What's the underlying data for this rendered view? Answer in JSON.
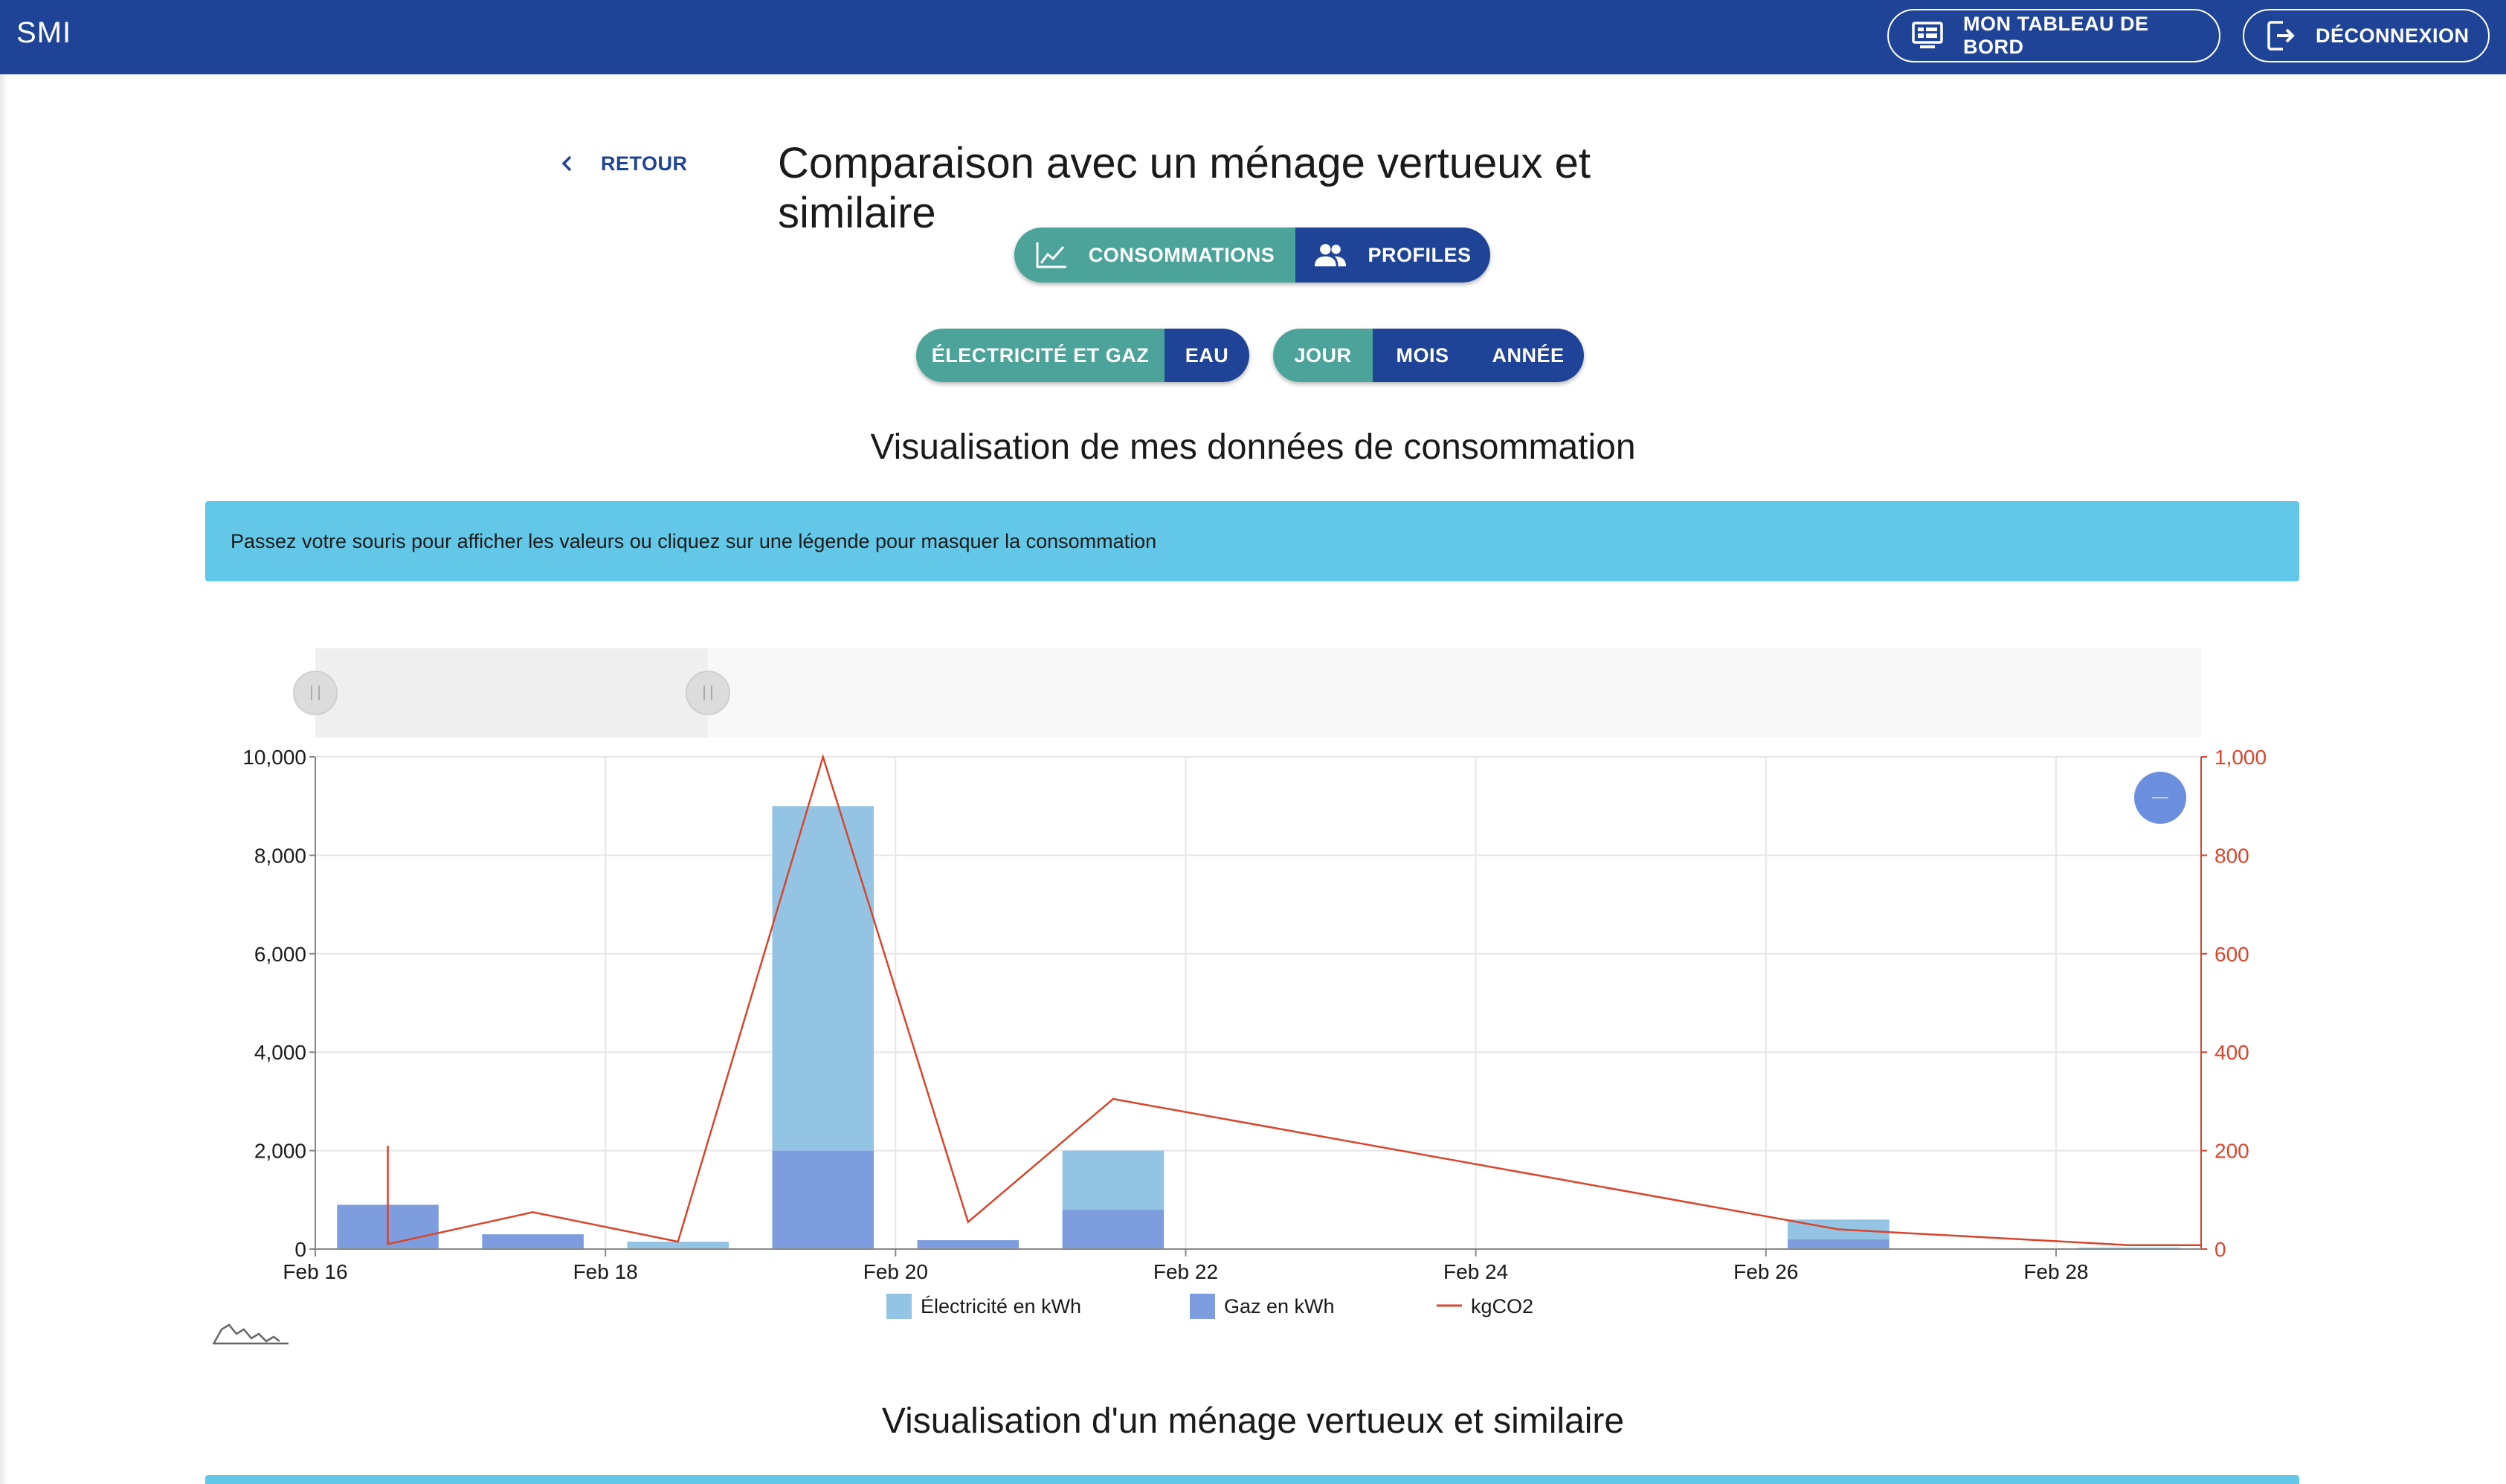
{
  "app": {
    "brand": "SMI",
    "dashboard_label": "MON TABLEAU DE BORD",
    "logout_label": "DÉCONNEXION"
  },
  "header": {
    "back_label": "RETOUR",
    "title": "Comparaison avec un ménage vertueux et similaire"
  },
  "views": {
    "options": [
      "CONSOMMATIONS",
      "PROFILES"
    ],
    "active": "CONSOMMATIONS"
  },
  "energy": {
    "options": [
      "ÉLECTRICITÉ ET GAZ",
      "EAU"
    ],
    "active": "ÉLECTRICITÉ ET GAZ"
  },
  "period": {
    "options": [
      "JOUR",
      "MOIS",
      "ANNÉE"
    ],
    "active": "JOUR"
  },
  "section1": {
    "title": "Visualisation de mes données de consommation",
    "info": "Passez votre souris pour afficher les valeurs ou cliquez sur une légende pour masquer la consommation"
  },
  "section2": {
    "title": "Visualisation d'un ménage vertueux et similaire"
  },
  "colors": {
    "topbar": "#1f4396",
    "toggle_active": "#4ba39a",
    "toggle_inactive": "#1f4396",
    "info_box": "#63c8e7",
    "electricity": "#93c4e3",
    "gas": "#7d9ddf",
    "co2": "#d9442b"
  },
  "chart_data": {
    "type": "bar",
    "stacked": true,
    "x_axis": {
      "type": "date",
      "range": [
        "2021-02-16",
        "2021-02-29"
      ],
      "tick_labels": [
        "Feb 16",
        "Feb 18",
        "Feb 20",
        "Feb 22",
        "Feb 24",
        "Feb 26",
        "Feb 28"
      ]
    },
    "y_left": {
      "range": [
        0,
        10000
      ],
      "tick_labels": [
        "0",
        "2,000",
        "4,000",
        "6,000",
        "8,000",
        "10,000"
      ]
    },
    "y_right": {
      "range": [
        0,
        1000
      ],
      "tick_labels": [
        "0",
        "200",
        "400",
        "600",
        "800",
        "1,000"
      ]
    },
    "grid": true,
    "legend_placement": "bottom-center",
    "series": [
      {
        "name": "Électricité en kWh",
        "type": "bar",
        "axis": "left",
        "points": [
          {
            "date": "2021-02-16",
            "value": 0
          },
          {
            "date": "2021-02-17",
            "value": 0
          },
          {
            "date": "2021-02-18",
            "value": 150
          },
          {
            "date": "2021-02-19",
            "value": 7000
          },
          {
            "date": "2021-02-20",
            "value": 0
          },
          {
            "date": "2021-02-21",
            "value": 1200
          },
          {
            "date": "2021-02-26",
            "value": 400
          },
          {
            "date": "2021-02-28",
            "value": 30
          }
        ]
      },
      {
        "name": "Gaz en kWh",
        "type": "bar",
        "axis": "left",
        "points": [
          {
            "date": "2021-02-16",
            "value": 900
          },
          {
            "date": "2021-02-17",
            "value": 300
          },
          {
            "date": "2021-02-18",
            "value": 0
          },
          {
            "date": "2021-02-19",
            "value": 2000
          },
          {
            "date": "2021-02-20",
            "value": 180
          },
          {
            "date": "2021-02-21",
            "value": 800
          },
          {
            "date": "2021-02-26",
            "value": 200
          },
          {
            "date": "2021-02-28",
            "value": 0
          }
        ]
      },
      {
        "name": "kgCO2",
        "type": "line",
        "axis": "right",
        "points": [
          {
            "date": "2021-02-16",
            "value": 10
          },
          {
            "date": "2021-02-17",
            "value": 75
          },
          {
            "date": "2021-02-18",
            "value": 15
          },
          {
            "date": "2021-02-19",
            "value": 1000
          },
          {
            "date": "2021-02-20",
            "value": 55
          },
          {
            "date": "2021-02-21",
            "value": 305
          },
          {
            "date": "2021-02-26",
            "value": 40
          },
          {
            "date": "2021-02-28",
            "value": 8
          },
          {
            "date": "2021-02-29",
            "value": 8
          }
        ],
        "spike": {
          "date": "2021-02-16",
          "from": 210,
          "to": 10
        }
      }
    ],
    "range_selector": {
      "from": "2021-02-16",
      "to": "2021-02-19"
    }
  }
}
